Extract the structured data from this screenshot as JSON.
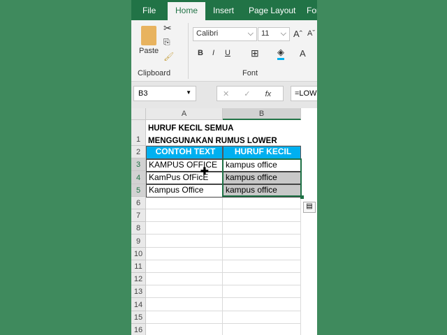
{
  "tabs": [
    "File",
    "Home",
    "Insert",
    "Page Layout",
    "For"
  ],
  "ribbon": {
    "paste": "Paste",
    "clipboard": "Clipboard",
    "font_group": "Font",
    "font_name": "Calibri",
    "font_size": "11",
    "bold": "B",
    "italic": "I",
    "underline": "U",
    "font_color": "A"
  },
  "formula_bar": {
    "name_box": "B3",
    "cancel": "✕",
    "enter": "✓",
    "fx": "fx",
    "formula": "=LOW"
  },
  "columns": [
    "A",
    "B"
  ],
  "rows": [
    "1",
    "2",
    "3",
    "4",
    "5",
    "6",
    "7",
    "8",
    "9",
    "10",
    "11",
    "12",
    "13",
    "14",
    "15",
    "16"
  ],
  "cells": {
    "title1": "HURUF KECIL SEMUA",
    "title2": "MENGGUNAKAN RUMUS LOWER",
    "h_a": "CONTOH TEXT",
    "h_b": "HURUF KECIL",
    "a": [
      "KAMPUS OFFICE",
      "KamPus OfFicE",
      "Kampus Office"
    ],
    "b": [
      "kampus office",
      "kampus office",
      "kampus office"
    ]
  },
  "colors": {
    "ribbon_green": "#217346",
    "header_fill": "#00b0f0",
    "selection": "#1e7145"
  }
}
